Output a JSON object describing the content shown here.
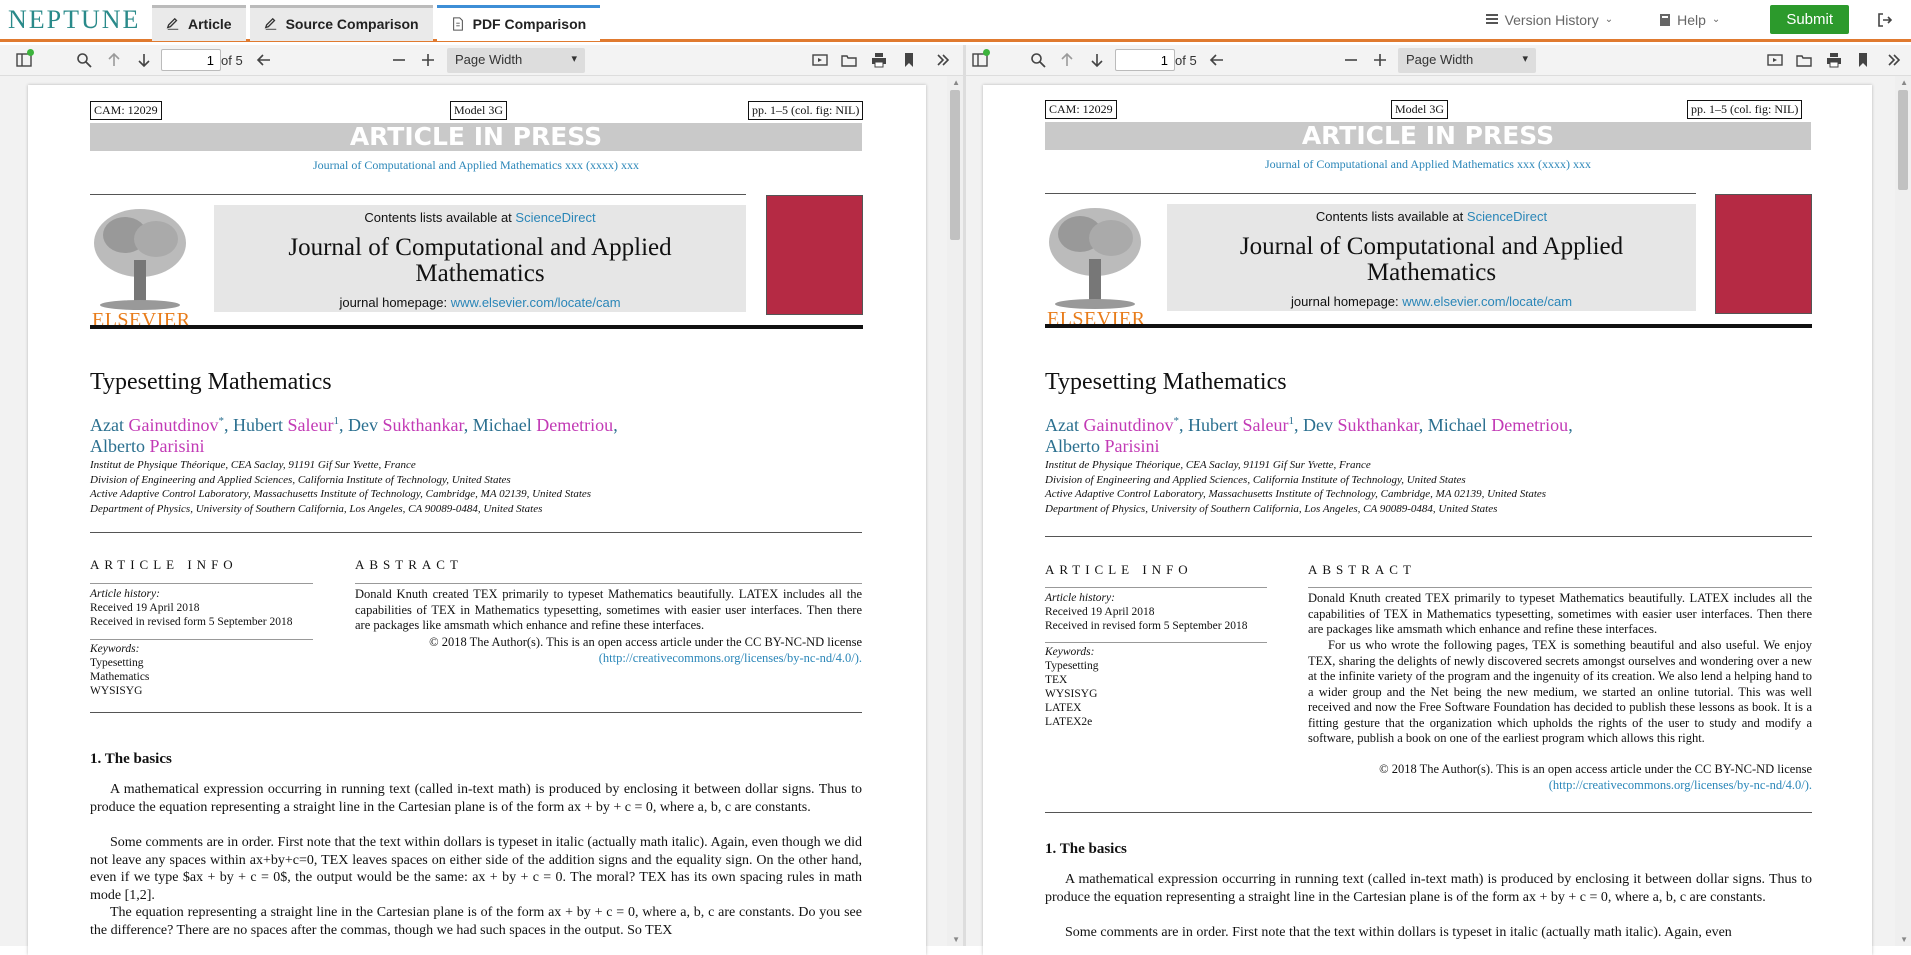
{
  "app": {
    "logo": "NEPTUNE",
    "tabs": [
      {
        "label": "Article"
      },
      {
        "label": "Source Comparison"
      },
      {
        "label": "PDF Comparison"
      }
    ],
    "version_history": "Version History",
    "help": "Help",
    "submit": "Submit"
  },
  "viewer": {
    "page": "1",
    "of": "of 5",
    "zoom": "Page Width"
  },
  "paper": {
    "cam": "CAM: 12029",
    "model": "Model 3G",
    "pp": "pp. 1–5 (col. fig: NIL)",
    "aip": "ARTICLE IN PRESS",
    "jref": "Journal of Computational and Applied Mathematics xxx (xxxx) xxx",
    "contents_pre": "Contents lists available at ",
    "contents_link": "ScienceDirect",
    "journal_title": "Journal of Computational and Applied Mathematics",
    "homepage_pre": "journal homepage: ",
    "homepage_link": "www.elsevier.com/locate/cam",
    "publisher": "ELSEVIER",
    "title": "Typesetting Mathematics",
    "authors": [
      {
        "first": "Azat",
        "last": "Gainutdinov",
        "mark": "*"
      },
      {
        "first": "Hubert",
        "last": "Saleur",
        "mark": "1"
      },
      {
        "first": "Dev",
        "last": "Sukthankar",
        "mark": ""
      },
      {
        "first": "Michael",
        "last": "Demetriou",
        "mark": ""
      },
      {
        "first": "Alberto",
        "last": "Parisini",
        "mark": ""
      }
    ],
    "affiliations": [
      "Institut de Physique Théorique, CEA Saclay, 91191 Gif Sur Yvette, France",
      "Division of Engineering and Applied Sciences, California Institute of Technology, United States",
      "Active Adaptive Control Laboratory, Massachusetts Institute of Technology, Cambridge, MA 02139, United States",
      "Department of Physics, University of Southern California, Los Angeles, CA 90089-0484, United States"
    ],
    "info_head": "ARTICLE INFO",
    "abs_head": "ABSTRACT",
    "history_label": "Article history:",
    "received": "Received 19 April 2018",
    "revised": "Received in revised form 5 September 2018",
    "kw_label": "Keywords:",
    "kw_left": [
      "Typesetting",
      "Mathematics",
      "WYSISYG"
    ],
    "kw_right": [
      "Typesetting",
      "TEX",
      "WYSISYG",
      "LATEX",
      "LATEX2e"
    ],
    "abs_p1": "Donald Knuth created TEX primarily to typeset Mathematics beautifully. LATEX includes all the capabilities of TEX in Mathematics typesetting, sometimes with easier user interfaces. Then there are packages like amsmath which enhance and refine these interfaces.",
    "abs_p2": "For us who wrote the following pages, TEX is something beautiful and also useful. We enjoy TEX, sharing the delights of newly discovered secrets amongst ourselves and wondering over a new at the infinite variety of the program and the ingenuity of its creation. We also lend a helping hand to a wider group and the Net being the new medium, we started an online tutorial. This was well received and now the Free Software Foundation has decided to publish these lessons as book. It is a fitting gesture that the organization which upholds the rights of the user to study and modify a software, publish a book on one of the earliest program which allows this right.",
    "copyright": "© 2018 The Author(s). This is an open access article under the CC BY-NC-ND license",
    "cc_link": "(http://creativecommons.org/licenses/by-nc-nd/4.0/).",
    "sec1": "1.  The basics",
    "para1": "A mathematical expression occurring in running text (called in-text math) is produced by enclosing it between dollar signs. Thus to produce the equation representing a straight line in the Cartesian plane is of the form ax + by + c = 0, where a, b, c are constants.",
    "para2": "Some comments are in order. First note that the text within dollars is typeset in italic (actually math italic). Again, even though we did not leave any spaces within ax+by+c=0, TEX leaves spaces on either side of the addition signs and the equality sign. On the other hand, even if we type $ax + by + c = 0$, the output would be the same: ax + by + c = 0. The moral? TEX has its own spacing rules in math mode [1,2].",
    "para3": "The equation representing a straight line in the Cartesian plane is of the form ax + by + c = 0, where a, b, c are constants. Do you see the difference? There are no spaces after the commas, though we had such spaces in the output. So TEX",
    "para2_cut": "Some comments are in order. First note that the text within dollars is typeset in italic (actually math italic). Again, even"
  }
}
